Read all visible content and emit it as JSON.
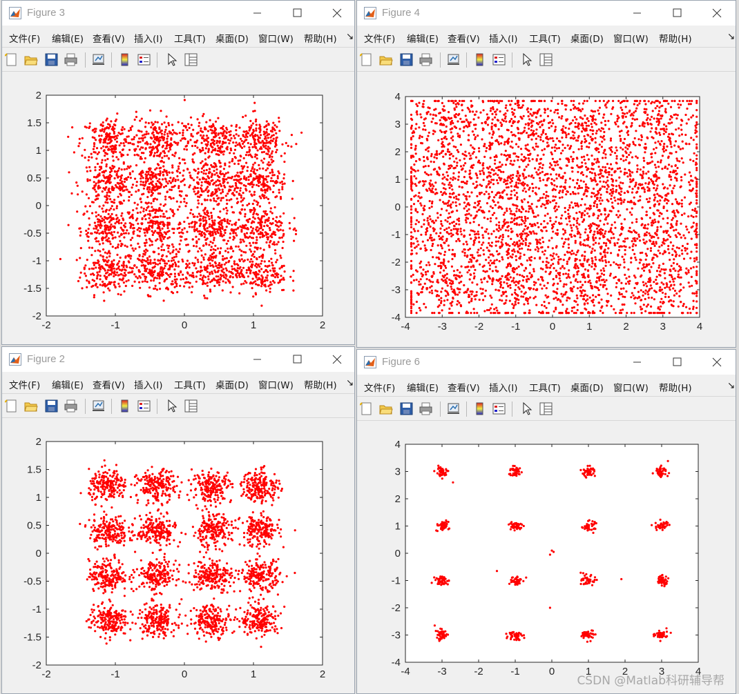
{
  "colors": {
    "marker": "#ff0000",
    "axes_bg": "#ffffff",
    "window_bg": "#f0f0f0",
    "title_text": "#9a9a9a"
  },
  "windows": {
    "fig3": {
      "title": "Figure 3"
    },
    "fig4": {
      "title": "Figure 4"
    },
    "fig2": {
      "title": "Figure 2"
    },
    "fig6": {
      "title": "Figure 6"
    }
  },
  "menu": [
    "文件(F)",
    "编辑(E)",
    "查看(V)",
    "插入(I)",
    "工具(T)",
    "桌面(D)",
    "窗口(W)",
    "帮助(H)"
  ],
  "menu_overflow_icon": "arrow-icon",
  "toolbar_icons": [
    "new-figure-icon",
    "open-file-icon",
    "save-icon",
    "print-icon",
    "link-plot-icon",
    "insert-colorbar-icon",
    "insert-legend-icon",
    "edit-plot-arrow-icon",
    "property-inspector-icon"
  ],
  "watermark": "CSDN @Matlab科研辅导帮",
  "chart_data": [
    {
      "window": "Figure 3",
      "type": "scatter",
      "marker": "red dots",
      "xlim": [
        -2,
        2
      ],
      "ylim": [
        -2,
        2
      ],
      "xticks": [
        "-2",
        "-1",
        "0",
        "1",
        "2"
      ],
      "yticks": [
        "2",
        "1.5",
        "1",
        "0.5",
        "0",
        "-0.5",
        "-1",
        "-1.5",
        "-2"
      ],
      "cluster_centers_x": [
        -1.1,
        -0.4,
        0.4,
        1.1
      ],
      "cluster_centers_y": [
        -1.2,
        -0.4,
        0.4,
        1.2
      ],
      "spread": 0.2,
      "noise_points": 250
    },
    {
      "window": "Figure 4",
      "type": "scatter",
      "marker": "red dots",
      "xlim": [
        -4,
        4
      ],
      "ylim": [
        -4,
        4
      ],
      "xticks": [
        "-4",
        "-3",
        "-2",
        "-1",
        "0",
        "1",
        "2",
        "3",
        "4"
      ],
      "yticks": [
        "4",
        "3",
        "2",
        "1",
        "0",
        "-1",
        "-2",
        "-3",
        "-4"
      ],
      "cluster_centers_x": [
        -3,
        -1,
        1,
        3
      ],
      "cluster_centers_y": [
        -3,
        -1,
        1,
        3
      ],
      "spread": 0.65,
      "noise_points": 700
    },
    {
      "window": "Figure 2",
      "type": "scatter",
      "marker": "red dots",
      "xlim": [
        -2,
        2
      ],
      "ylim": [
        -2,
        2
      ],
      "xticks": [
        "-2",
        "-1",
        "0",
        "1",
        "2"
      ],
      "yticks": [
        "2",
        "1.5",
        "1",
        "0.5",
        "0",
        "-0.5",
        "-1",
        "-1.5",
        "-2"
      ],
      "cluster_centers_x": [
        -1.1,
        -0.4,
        0.4,
        1.1
      ],
      "cluster_centers_y": [
        -1.2,
        -0.4,
        0.4,
        1.2
      ],
      "spread": 0.14,
      "noise_points": 60
    },
    {
      "window": "Figure 6",
      "type": "scatter",
      "marker": "red dots",
      "xlim": [
        -4,
        4
      ],
      "ylim": [
        -4,
        4
      ],
      "xticks": [
        "-4",
        "-3",
        "-2",
        "-1",
        "0",
        "1",
        "2",
        "3",
        "4"
      ],
      "yticks": [
        "4",
        "3",
        "2",
        "1",
        "0",
        "-1",
        "-2",
        "-3",
        "-4"
      ],
      "cluster_centers_x": [
        -3,
        -1,
        1,
        3
      ],
      "cluster_centers_y": [
        -3,
        -1,
        1,
        3
      ],
      "spread": 0.09,
      "outliers": [
        [
          -2.7,
          2.6
        ],
        [
          -1.5,
          -0.65
        ],
        [
          0,
          0.1
        ],
        [
          -0.05,
          -0.05
        ],
        [
          0.05,
          0.05
        ],
        [
          -0.05,
          -2
        ],
        [
          1.9,
          -0.95
        ],
        [
          -3.2,
          -2.65
        ]
      ]
    }
  ]
}
